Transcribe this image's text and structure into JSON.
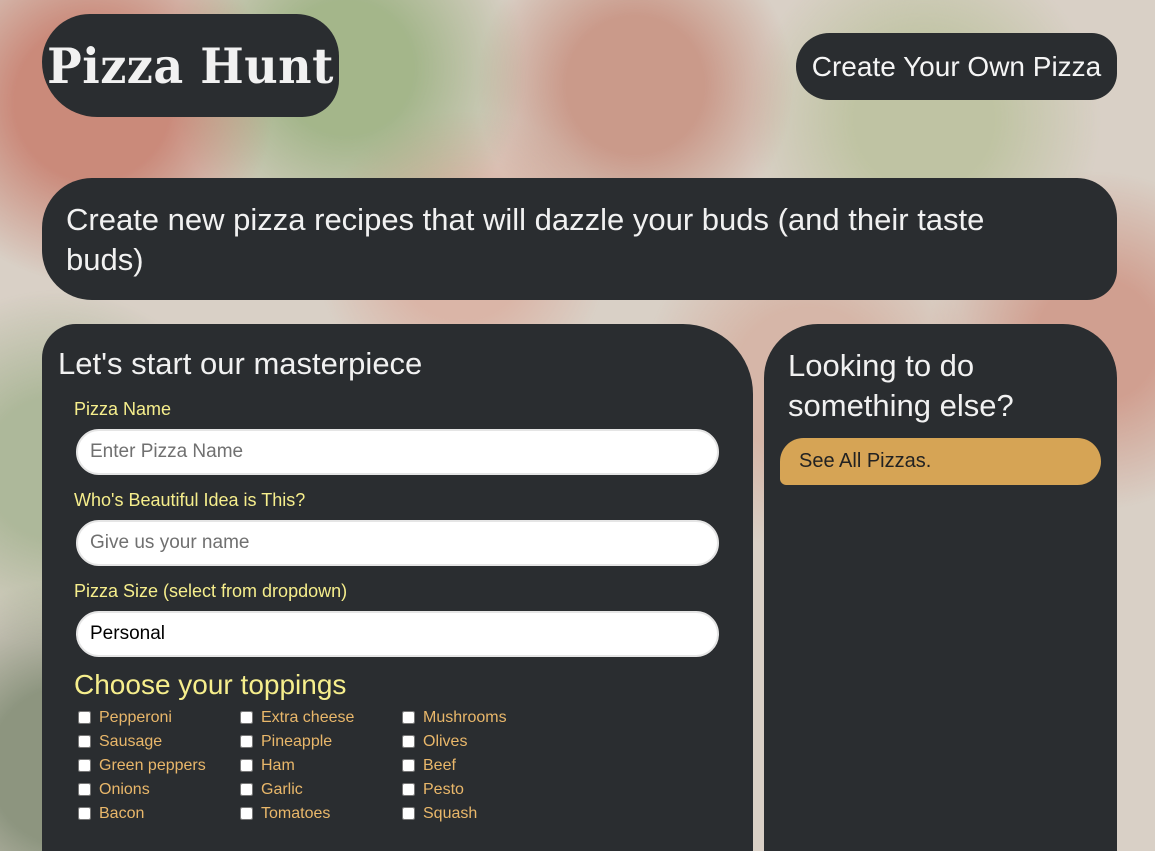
{
  "brand": {
    "logo_text": "Pizza Hunt"
  },
  "nav": {
    "create_label": "Create Your Own Pizza"
  },
  "hero": {
    "text": "Create new pizza recipes that will dazzle your buds (and their taste buds)"
  },
  "form": {
    "heading": "Let's start our masterpiece",
    "pizza_name": {
      "label": "Pizza Name",
      "placeholder": "Enter Pizza Name"
    },
    "creator": {
      "label": "Who's Beautiful Idea is This?",
      "placeholder": "Give us your name"
    },
    "size": {
      "label": "Pizza Size (select from dropdown)",
      "selected": "Personal"
    },
    "toppings_heading": "Choose your toppings",
    "toppings": [
      "Pepperoni",
      "Extra cheese",
      "Mushrooms",
      "Sausage",
      "Pineapple",
      "Olives",
      "Green peppers",
      "Ham",
      "Beef",
      "Onions",
      "Garlic",
      "Pesto",
      "Bacon",
      "Tomatoes",
      "Squash"
    ]
  },
  "sidebar": {
    "heading": "Looking to do something else?",
    "see_all_label": "See All Pizzas."
  }
}
